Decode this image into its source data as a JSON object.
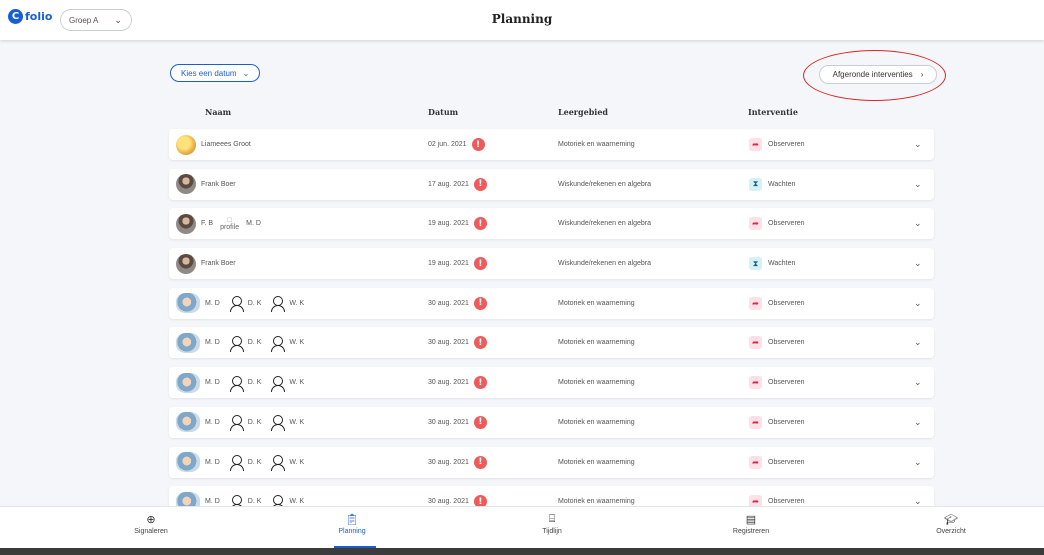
{
  "app": {
    "logo_text": "folio",
    "logo_mark": "C"
  },
  "header": {
    "group_select": "Groep A",
    "title": "Planning"
  },
  "toolbar": {
    "date_button": "Kies een datum",
    "completed_button": "Afgeronde interventies"
  },
  "columns": {
    "name": "Naam",
    "date": "Datum",
    "area": "Leergebied",
    "intervention": "Interventie"
  },
  "rows": [
    {
      "names": [
        "Liameees Groot"
      ],
      "date": "02 jun. 2021",
      "area": "Motoriek en waarneming",
      "intervention": "Observeren",
      "icon": "observe-icon",
      "avatar": "sun"
    },
    {
      "names": [
        "Frank Boer"
      ],
      "date": "17 aug. 2021",
      "area": "Wiskunde/rekenen en algebra",
      "intervention": "Wachten",
      "icon": "hourglass-icon",
      "avatar": "man"
    },
    {
      "names": [
        "F. B",
        "profile",
        "M. D"
      ],
      "date": "19 aug. 2021",
      "area": "Wiskunde/rekenen en algebra",
      "intervention": "Observeren",
      "icon": "observe-icon",
      "avatar": "man"
    },
    {
      "names": [
        "Frank Boer"
      ],
      "date": "19 aug. 2021",
      "area": "Wiskunde/rekenen en algebra",
      "intervention": "Wachten",
      "icon": "hourglass-icon",
      "avatar": "man"
    },
    {
      "names": [
        "M. D",
        "D. K",
        "W. K"
      ],
      "date": "30 aug. 2021",
      "area": "Motoriek en waarneming",
      "intervention": "Observeren",
      "icon": "observe-icon",
      "avatar": "kid"
    },
    {
      "names": [
        "M. D",
        "D. K",
        "W. K"
      ],
      "date": "30 aug. 2021",
      "area": "Motoriek en waarneming",
      "intervention": "Observeren",
      "icon": "observe-icon",
      "avatar": "kid"
    },
    {
      "names": [
        "M. D",
        "D. K",
        "W. K"
      ],
      "date": "30 aug. 2021",
      "area": "Motoriek en waarneming",
      "intervention": "Observeren",
      "icon": "observe-icon",
      "avatar": "kid"
    },
    {
      "names": [
        "M. D",
        "D. K",
        "W. K"
      ],
      "date": "30 aug. 2021",
      "area": "Motoriek en waarneming",
      "intervention": "Observeren",
      "icon": "observe-icon",
      "avatar": "kid"
    },
    {
      "names": [
        "M. D",
        "D. K",
        "W. K"
      ],
      "date": "30 aug. 2021",
      "area": "Motoriek en waarneming",
      "intervention": "Observeren",
      "icon": "observe-icon",
      "avatar": "kid"
    },
    {
      "names": [
        "M. D",
        "D. K",
        "W. K"
      ],
      "date": "30 aug. 2021",
      "area": "Motoriek en waarneming",
      "intervention": "Observeren",
      "icon": "observe-icon",
      "avatar": "kid"
    }
  ],
  "nav": [
    {
      "label": "Signaleren",
      "icon": "plus-circle-icon"
    },
    {
      "label": "Planning",
      "icon": "clipboard-icon",
      "active": true
    },
    {
      "label": "Tijdlijn",
      "icon": "backpack-icon"
    },
    {
      "label": "Registreren",
      "icon": "id-card-icon"
    },
    {
      "label": "Overzicht",
      "icon": "graduation-cap-icon"
    }
  ],
  "colors": {
    "accent": "#1a5fd0",
    "alert": "#ef5a5a",
    "observe": "#e0244a",
    "wait": "#136b85",
    "annotation": "#d92525"
  }
}
